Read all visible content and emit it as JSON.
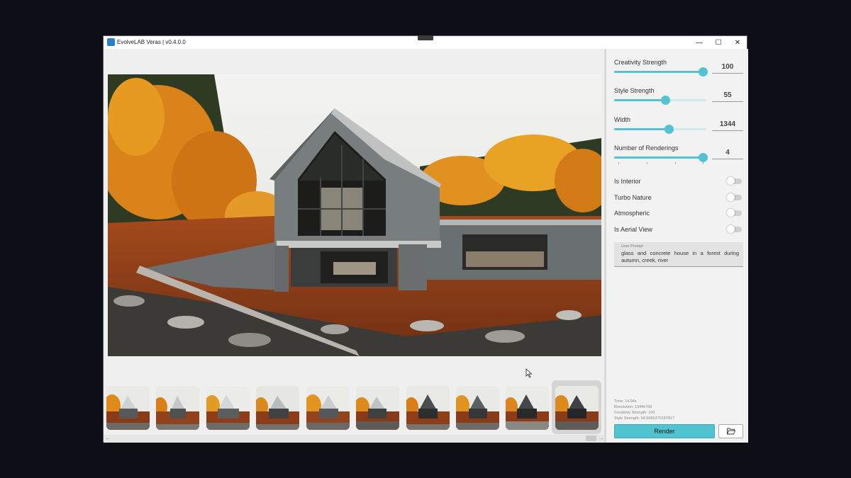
{
  "window": {
    "title": "EvolveLAB Veras | v0.4.0.0"
  },
  "controls": {
    "minimize": "—",
    "maximize": "☐",
    "close": "✕"
  },
  "sliders": [
    {
      "label": "Creativity Strength",
      "value": "100",
      "fraction": 0.96
    },
    {
      "label": "Style Strength",
      "value": "55",
      "fraction": 0.55
    },
    {
      "label": "Width",
      "value": "1344",
      "fraction": 0.59
    },
    {
      "label": "Number of Renderings",
      "value": "4",
      "fraction": 0.96
    }
  ],
  "toggles": [
    {
      "label": "Is Interior",
      "on": false
    },
    {
      "label": "Turbo Nature",
      "on": false
    },
    {
      "label": "Atmospheric",
      "on": false
    },
    {
      "label": "Is Aerial View",
      "on": false
    }
  ],
  "prompt": {
    "label": "User Prompt",
    "text": "glass and concrete house in a forest during autumn, creek, river"
  },
  "stats": {
    "time": "Time: 14.94s",
    "resolution": "Resolution: 1344x768",
    "creativity": "Creativity Strength: 100",
    "style": "Style Strength: 54.5685279187817"
  },
  "buttons": {
    "render": "Render"
  },
  "gallery": {
    "count": 10,
    "selected_index": 9
  },
  "colors": {
    "accent": "#52c3d0",
    "window_bg": "#efefef",
    "desktop_bg": "#0e0f16"
  },
  "icons": {
    "app": "veras-app-icon",
    "folder": "folder-open-icon",
    "cursor": "mouse-pointer-icon"
  }
}
